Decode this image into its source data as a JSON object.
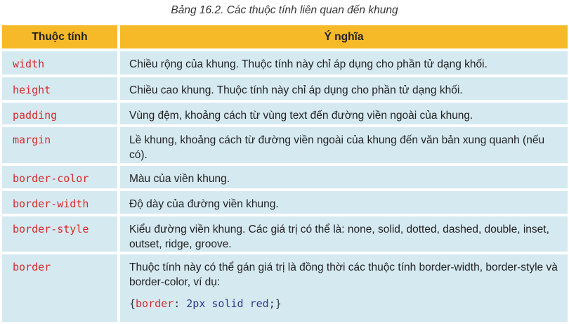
{
  "caption": "Bảng 16.2. Các thuộc tính liên quan đến khung",
  "header": {
    "col1": "Thuộc tính",
    "col2": "Ý nghĩa"
  },
  "rows": [
    {
      "prop": "width",
      "desc": "Chiều rộng của khung. Thuộc tính này chỉ áp dụng cho phần tử dạng khối."
    },
    {
      "prop": "height",
      "desc": "Chiều cao khung. Thuộc tính này chỉ áp dụng cho phần tử dạng khối."
    },
    {
      "prop": "padding",
      "desc": "Vùng đệm, khoảng cách từ vùng text đến đường viền ngoài của khung."
    },
    {
      "prop": "margin",
      "desc": "Lề khung, khoảng cách từ đường viền ngoài của khung đến văn bản xung quanh (nếu có)."
    },
    {
      "prop": "border-color",
      "desc": "Màu của viền khung."
    },
    {
      "prop": "border-width",
      "desc": "Độ dày của đường viền khung."
    },
    {
      "prop": "border-style",
      "desc": "Kiểu đường viền khung. Các giá trị có thể là: none, solid, dotted, dashed, double, inset, outset, ridge, groove."
    },
    {
      "prop": "border",
      "desc": "Thuộc tính này có thể gán giá trị là đồng thời các thuộc tính border-width, border-style và border-color, ví dụ:"
    }
  ],
  "example": {
    "open": "{",
    "property": "border",
    "colon": ":",
    "value": "2px solid red",
    "close": ";}"
  },
  "colors": {
    "header": "#f6b928",
    "row": "#d5e9f1",
    "property_text": "#d62b2b"
  }
}
